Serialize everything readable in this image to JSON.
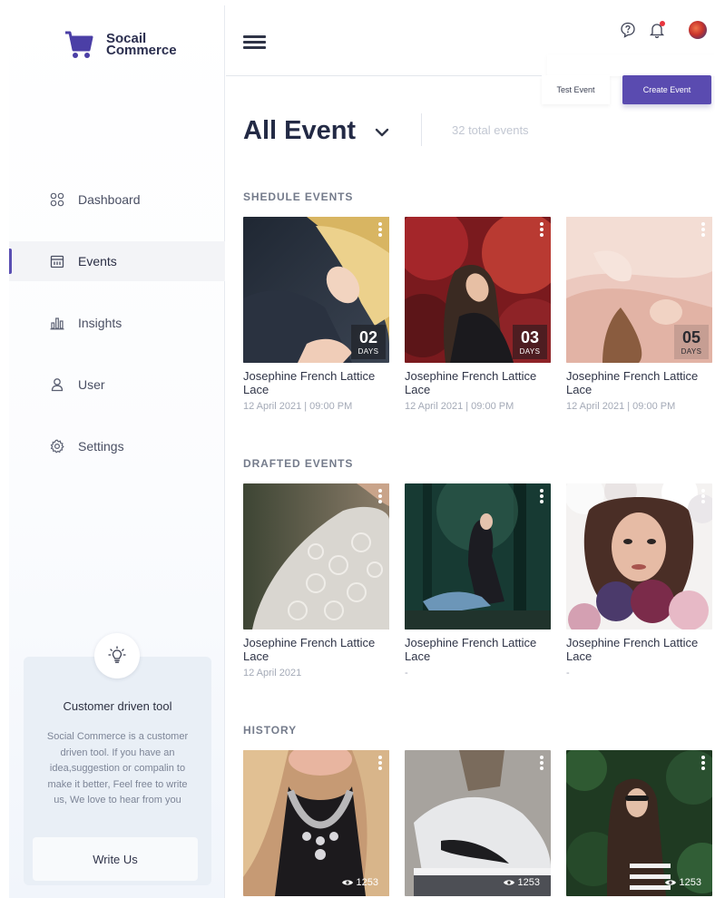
{
  "brand": {
    "name": "Socail Commerce",
    "accent": "#5a4bb0"
  },
  "sidebar": {
    "items": [
      {
        "label": "Dashboard",
        "icon": "grid-circles-icon",
        "active": false
      },
      {
        "label": "Events",
        "icon": "calendar-icon",
        "active": true
      },
      {
        "label": "Insights",
        "icon": "bar-chart-icon",
        "active": false
      },
      {
        "label": "User",
        "icon": "user-icon",
        "active": false
      },
      {
        "label": "Settings",
        "icon": "gear-icon",
        "active": false
      }
    ],
    "tool_card": {
      "icon": "lightbulb-icon",
      "title": "Customer driven tool",
      "text": "Social Commerce is a customer driven tool. If you have an idea,suggestion or compalin to make it better, Feel free to write us, We love to hear from you",
      "button": "Write Us"
    }
  },
  "topbar": {
    "icons": [
      "help-bubble-icon",
      "bell-icon",
      "avatar"
    ],
    "notification_color": "#e8343d"
  },
  "actions": {
    "test_event": "Test Event",
    "create_event": "Create Event"
  },
  "header": {
    "title": "All Event",
    "total": "32 total events"
  },
  "sections": {
    "scheduled": {
      "title": "SHEDULE EVENTS",
      "cards": [
        {
          "title": "Josephine French Lattice Lace",
          "date": "12 April 2021 | 09:00 PM",
          "days": "02",
          "days_label": "DAYS"
        },
        {
          "title": "Josephine French Lattice Lace",
          "date": "12 April 2021 | 09:00 PM",
          "days": "03",
          "days_label": "DAYS"
        },
        {
          "title": "Josephine French Lattice Lace",
          "date": "12 April 2021 | 09:00 PM",
          "days": "05",
          "days_label": "DAYS"
        }
      ]
    },
    "drafted": {
      "title": "DRAFTED EVENTS",
      "cards": [
        {
          "title": "Josephine French Lattice Lace",
          "date": "12 April 2021"
        },
        {
          "title": "Josephine French Lattice Lace",
          "date": "-"
        },
        {
          "title": "Josephine French Lattice Lace",
          "date": "-"
        }
      ]
    },
    "history": {
      "title": "HISTORY",
      "cards": [
        {
          "views": "1253"
        },
        {
          "views": "1253"
        },
        {
          "views": "1253"
        }
      ]
    }
  }
}
